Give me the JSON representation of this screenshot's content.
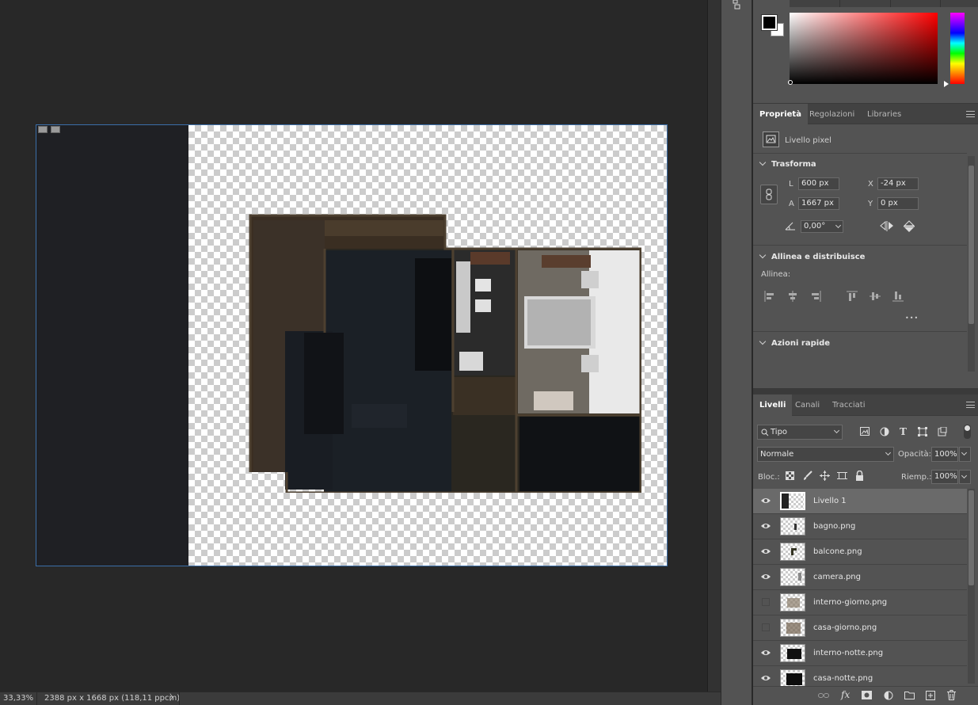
{
  "status": {
    "zoom": "33,33%",
    "doc_info": "2388 px x 1668 px (118,11 ppcm)",
    "arrow": "〉"
  },
  "properties_panel": {
    "tabs": [
      "Proprietà",
      "Regolazioni",
      "Libraries"
    ],
    "layer_type": "Livello pixel",
    "transform": {
      "title": "Trasforma",
      "w_label": "L",
      "w_value": "600 px",
      "h_label": "A",
      "h_value": "1667 px",
      "x_label": "X",
      "x_value": "-24 px",
      "y_label": "Y",
      "y_value": "0 px",
      "angle_value": "0,00°"
    },
    "align": {
      "title": "Allinea e distribuisce",
      "subtitle": "Allinea:",
      "more": "•••"
    },
    "quick_actions": {
      "title": "Azioni rapide"
    }
  },
  "layers_panel": {
    "tabs": [
      "Livelli",
      "Canali",
      "Tracciati"
    ],
    "filter_value": "Tipo",
    "blend_mode": "Normale",
    "opacity_label": "Opacità:",
    "opacity_value": "100%",
    "lock_label": "Bloc.:",
    "fill_label": "Riemp.:",
    "fill_value": "100%",
    "layers": [
      {
        "name": "Livello 1",
        "visible": true,
        "selected": true
      },
      {
        "name": "bagno.png",
        "visible": true,
        "selected": false
      },
      {
        "name": "balcone.png",
        "visible": true,
        "selected": false
      },
      {
        "name": "camera.png",
        "visible": true,
        "selected": false
      },
      {
        "name": "interno-giorno.png",
        "visible": false,
        "selected": false
      },
      {
        "name": "casa-giorno.png",
        "visible": false,
        "selected": false
      },
      {
        "name": "interno-notte.png",
        "visible": true,
        "selected": false
      },
      {
        "name": "casa-notte.png",
        "visible": true,
        "selected": false
      }
    ],
    "bottom_icons": [
      "link-icon",
      "fx-icon",
      "mask-icon",
      "adjustment-icon",
      "folder-icon",
      "new-layer-icon",
      "trash-icon"
    ],
    "fx_text": "fx"
  },
  "colors": {
    "foreground": "#000000",
    "background": "#ffffff",
    "picker_hue": "#ff0000"
  }
}
